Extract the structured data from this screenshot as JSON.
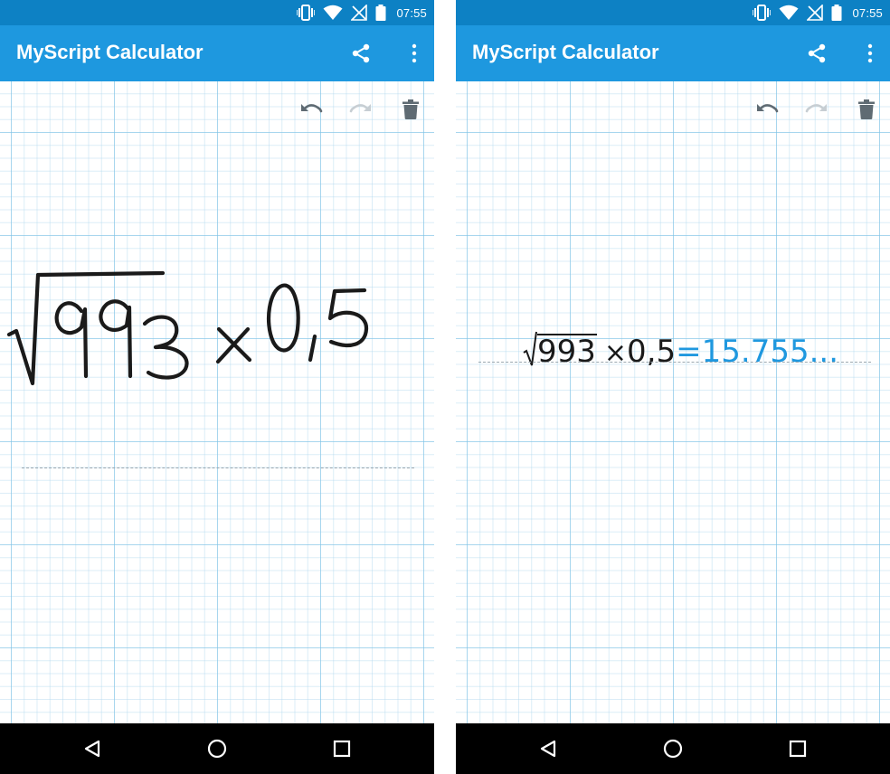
{
  "status_bar": {
    "time": "07:55",
    "icons": [
      "vibrate-icon",
      "wifi-icon",
      "no-signal-icon",
      "battery-icon"
    ]
  },
  "app_bar": {
    "title": "MyScript Calculator",
    "actions": [
      "share-icon",
      "more-vert-icon"
    ]
  },
  "toolbar": {
    "actions": [
      "undo-icon",
      "redo-icon",
      "delete-icon"
    ]
  },
  "screens": {
    "handwritten": {
      "radicand_digits": [
        "9",
        "9",
        "3"
      ],
      "operator": "×",
      "operand": "0,5"
    },
    "recognized": {
      "radicand": "993",
      "operator": "×",
      "operand": "0,5",
      "equals": "=",
      "result": "15.755..."
    }
  },
  "nav_bar": {
    "buttons": [
      "back-icon",
      "home-icon",
      "recents-icon"
    ]
  },
  "colors": {
    "status_bar": "#0d81c4",
    "app_bar": "#1e98df",
    "result_text": "#1f98df",
    "ink": "#1a1a1a",
    "nav_bar": "#000000"
  }
}
